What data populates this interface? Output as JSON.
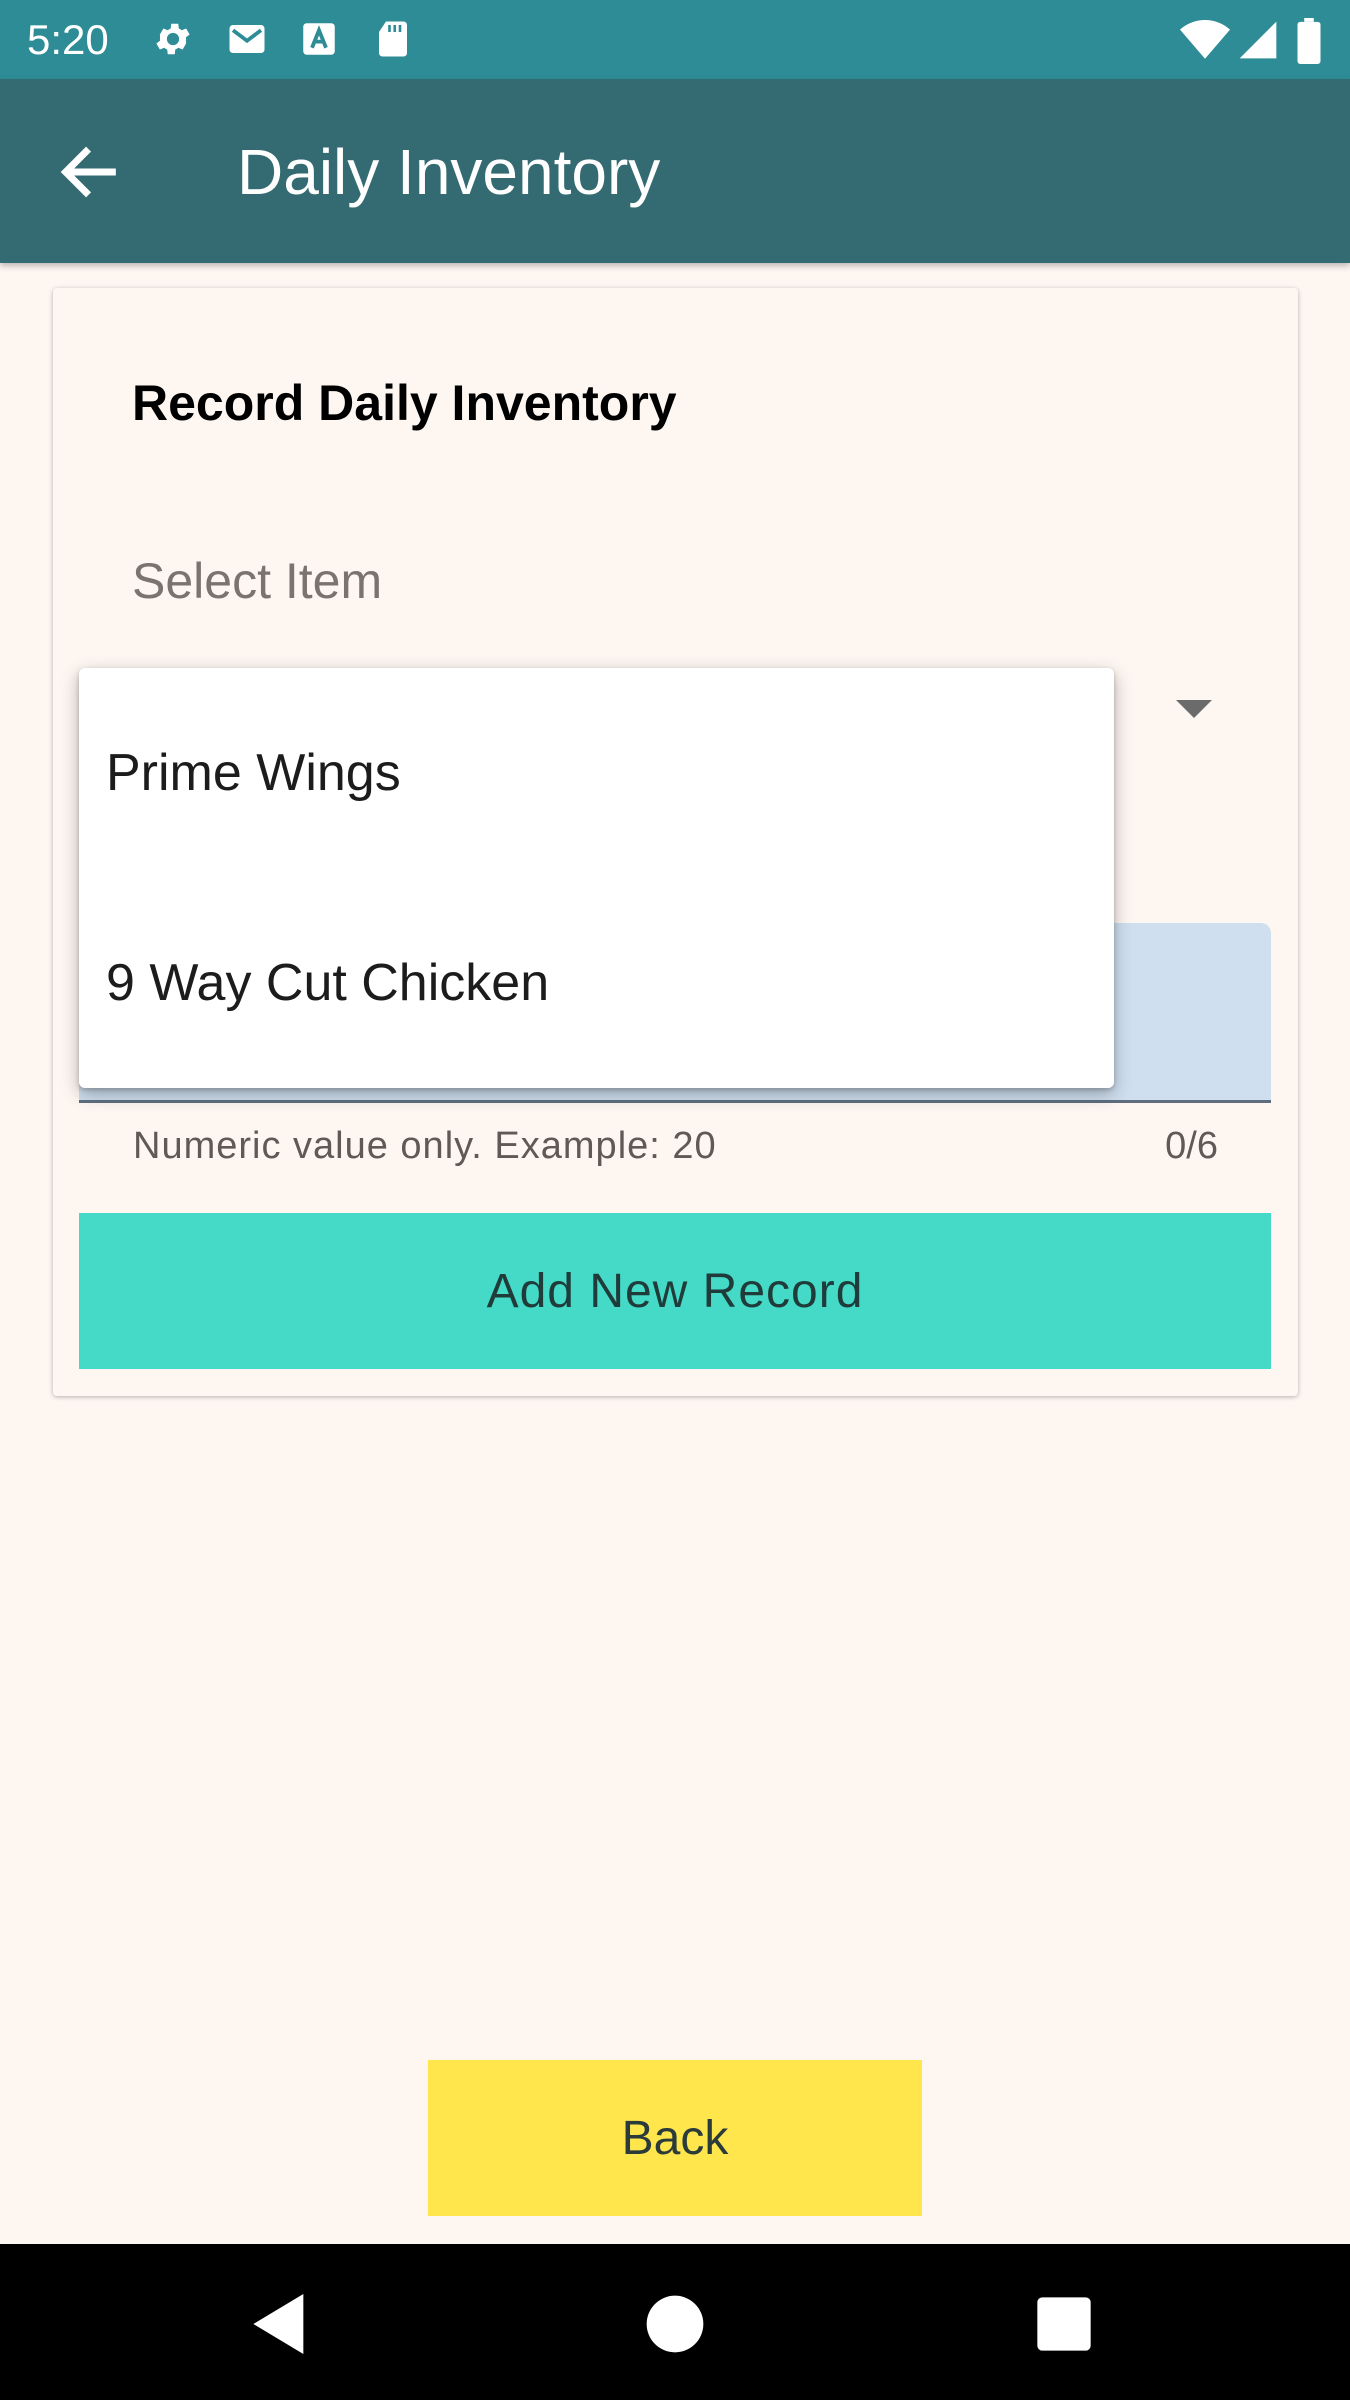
{
  "status_bar": {
    "time": "5:20",
    "left_icons": [
      "gear-icon",
      "gmail-icon",
      "a-font-icon",
      "sd-card-icon"
    ],
    "right_icons": [
      "wifi-icon",
      "signal-icon",
      "battery-icon"
    ]
  },
  "app_bar": {
    "title": "Daily Inventory",
    "back_icon": "arrow-left-icon"
  },
  "card": {
    "title": "Record Daily Inventory",
    "select_label": "Select Item",
    "quantity_field": {
      "value": "",
      "helper_text": "Numeric value only. Example: 20",
      "counter": "0/6",
      "max_length": 6
    },
    "add_button_label": "Add New Record"
  },
  "dropdown": {
    "options": [
      "Prime Wings",
      "9 Way Cut Chicken"
    ]
  },
  "back_button_label": "Back",
  "nav_bar": {
    "buttons": [
      "back-triangle-icon",
      "home-circle-icon",
      "recents-square-icon"
    ]
  },
  "colors": {
    "status_bar": "#2e8c96",
    "app_bar": "#346b72",
    "background": "#fdf6f1",
    "field_fill": "#cfdfef",
    "add_button": "#45d9c7",
    "back_button": "#ffe64d"
  }
}
